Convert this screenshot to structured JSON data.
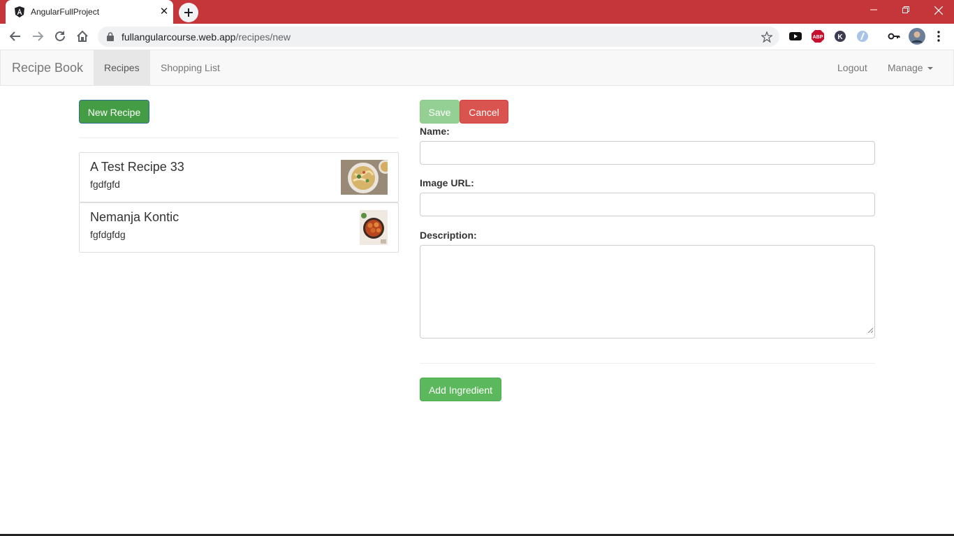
{
  "browser": {
    "tab_title": "AngularFullProject",
    "url_host": "fullangularcourse.web.app",
    "url_path": "/recipes/new",
    "colors": {
      "tabstrip": "#c5363b",
      "omnibox": "#f0f1f2"
    }
  },
  "navbar": {
    "brand": "Recipe Book",
    "links": [
      {
        "label": "Recipes",
        "active": true
      },
      {
        "label": "Shopping List",
        "active": false
      }
    ],
    "logout": "Logout",
    "manage": "Manage"
  },
  "list": {
    "new_button": "New Recipe",
    "recipes": [
      {
        "name": "A Test Recipe 33",
        "description": "fgdfgfd",
        "image_icon": "pasta-bowl-photo"
      },
      {
        "name": "Nemanja Kontic",
        "description": "fgfdgfdg",
        "image_icon": "meatballs-pan-photo"
      }
    ]
  },
  "form": {
    "save": "Save",
    "cancel": "Cancel",
    "name_label": "Name:",
    "name_value": "",
    "image_label": "Image URL:",
    "image_value": "",
    "description_label": "Description:",
    "description_value": "",
    "add_ingredient": "Add Ingredient"
  },
  "colors": {
    "success": "#5cb85c",
    "danger": "#d9534f"
  }
}
